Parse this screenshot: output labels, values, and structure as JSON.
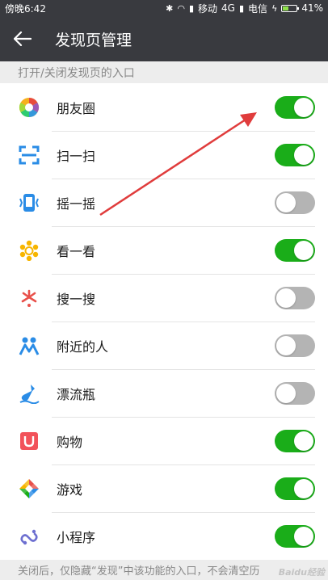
{
  "status_bar": {
    "time": "傍晚6:42",
    "carrier1": "移动",
    "network": "4G",
    "carrier2": "电信",
    "battery": "41%",
    "battery_level": 0.41
  },
  "nav": {
    "title": "发现页管理"
  },
  "section_header": "打开/关闭发现页的入口",
  "items": [
    {
      "label": "朋友圈",
      "icon": "moments-icon",
      "enabled": true
    },
    {
      "label": "扫一扫",
      "icon": "scan-icon",
      "enabled": true
    },
    {
      "label": "摇一摇",
      "icon": "shake-icon",
      "enabled": false
    },
    {
      "label": "看一看",
      "icon": "top-stories-icon",
      "enabled": true
    },
    {
      "label": "搜一搜",
      "icon": "search-icon",
      "enabled": false
    },
    {
      "label": "附近的人",
      "icon": "people-nearby-icon",
      "enabled": false
    },
    {
      "label": "漂流瓶",
      "icon": "drift-bottle-icon",
      "enabled": false
    },
    {
      "label": "购物",
      "icon": "shopping-icon",
      "enabled": true
    },
    {
      "label": "游戏",
      "icon": "games-icon",
      "enabled": true
    },
    {
      "label": "小程序",
      "icon": "mini-program-icon",
      "enabled": true
    }
  ],
  "footer_note": "关闭后，仅隐藏“发现”中该功能的入口，不会清空历",
  "watermark": "Baidu经验",
  "colors": {
    "toggle_on": "#1aad19",
    "toggle_off": "#b4b4b4",
    "header_bg": "#393a3f",
    "annotation_arrow": "#e03c3c"
  }
}
